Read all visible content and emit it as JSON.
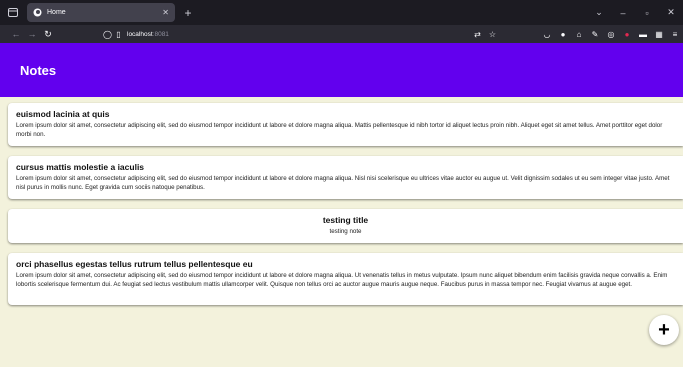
{
  "browser": {
    "tab": {
      "title": "Home"
    },
    "url": {
      "host": "localhost",
      "port": ":8081"
    },
    "accent_colors": {
      "chrome_dark": "#1c1b22",
      "toolbar": "#2b2a33",
      "tab_active": "#42414d"
    }
  },
  "app": {
    "title": "Notes",
    "header_color": "#6200ee",
    "background_color": "#f3f2dc"
  },
  "notes": [
    {
      "title": "euismod lacinia at quis",
      "content": "Lorem ipsum dolor sit amet, consectetur adipiscing elit, sed do eiusmod tempor incididunt ut labore et dolore magna aliqua. Mattis pellentesque id nibh tortor id aliquet lectus proin nibh. Aliquet eget sit amet tellus. Amet porttitor eget dolor morbi non."
    },
    {
      "title": "cursus mattis molestie a iaculis",
      "content": "Lorem ipsum dolor sit amet, consectetur adipiscing elit, sed do eiusmod tempor incididunt ut labore et dolore magna aliqua. Nisl nisi scelerisque eu ultrices vitae auctor eu augue ut. Velit dignissim sodales ut eu sem integer vitae justo. Amet nisl purus in mollis nunc. Eget gravida cum sociis natoque penatibus."
    },
    {
      "title": "testing title",
      "content": "testing note"
    },
    {
      "title": "orci phasellus egestas tellus rutrum tellus pellentesque eu",
      "content": "Lorem ipsum dolor sit amet, consectetur adipiscing elit, sed do eiusmod tempor incididunt ut labore et dolore magna aliqua. Ut venenatis tellus in metus vulputate. Ipsum nunc aliquet bibendum enim facilisis gravida neque convallis a. Enim lobortis scelerisque fermentum dui. Ac feugiat sed lectus vestibulum mattis ullamcorper velit. Quisque non tellus orci ac auctor augue mauris augue neque. Faucibus purus in massa tempor nec. Feugiat vivamus at augue eget."
    }
  ],
  "fab": {
    "label": "+"
  }
}
